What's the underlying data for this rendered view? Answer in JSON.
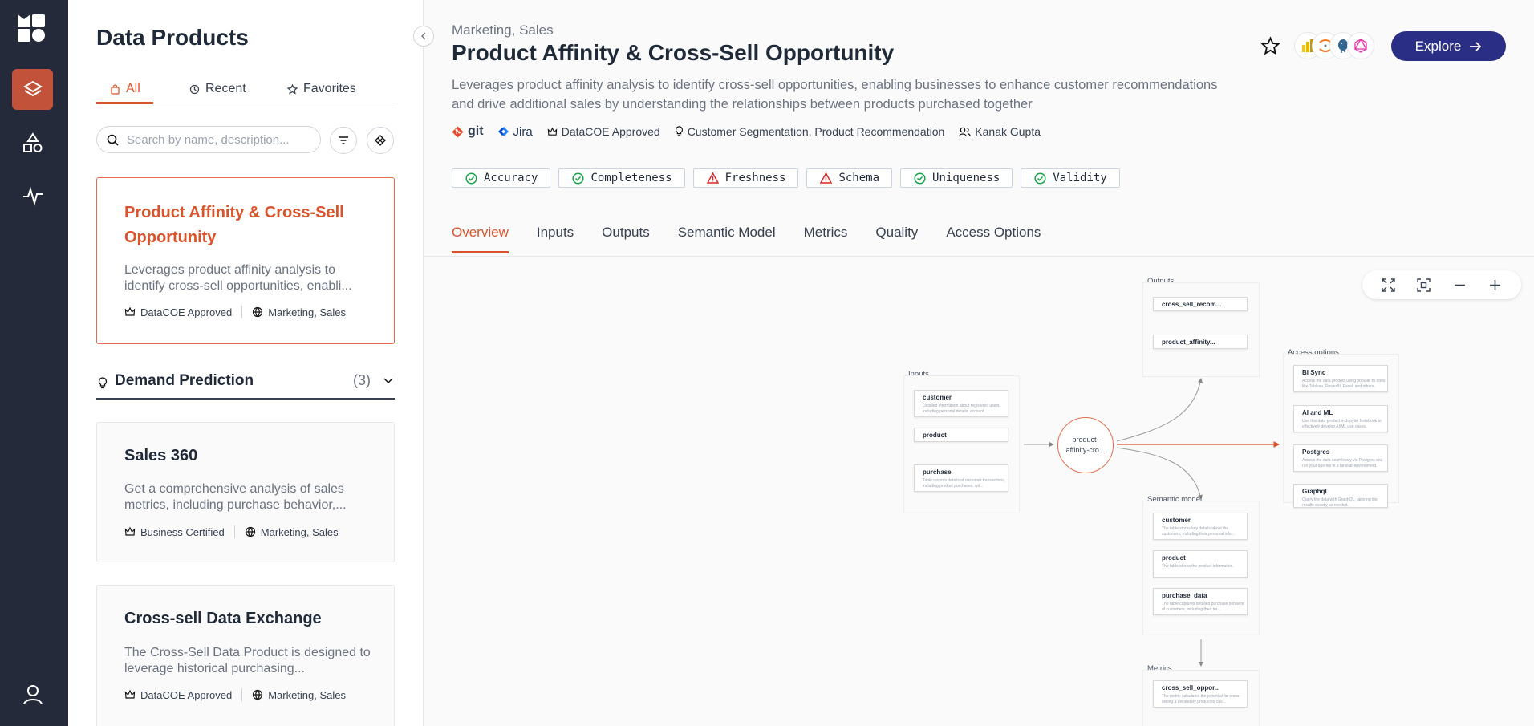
{
  "sidebar": {
    "title": "Data Products",
    "tabs": [
      {
        "label": "All",
        "active": true
      },
      {
        "label": "Recent",
        "active": false
      },
      {
        "label": "Favorites",
        "active": false
      }
    ],
    "search_placeholder": "Search by name, description...",
    "cards_top": [
      {
        "title": "Product Affinity & Cross-Sell Opportunity",
        "desc": "Leverages product affinity analysis to identify cross-sell opportunities, enabli...",
        "badge": "DataCOE Approved",
        "domain": "Marketing, Sales"
      }
    ],
    "group": {
      "title": "Demand Prediction",
      "count": "(3)"
    },
    "cards_group": [
      {
        "title": "Sales 360",
        "desc": "Get a comprehensive analysis of sales metrics, including purchase behavior,...",
        "badge": "Business Certified",
        "domain": "Marketing, Sales"
      },
      {
        "title": "Cross-sell Data Exchange",
        "desc": "The Cross-Sell Data Product is designed to leverage historical purchasing...",
        "badge": "DataCOE Approved",
        "domain": "Marketing, Sales"
      }
    ]
  },
  "main": {
    "domain": "Marketing, Sales",
    "title": "Product Affinity & Cross-Sell Opportunity",
    "desc": "Leverages product affinity analysis to identify cross-sell opportunities, enabling businesses to enhance customer recommendations and drive additional sales by understanding the relationships between products purchased together",
    "meta": {
      "git": "git",
      "jira": "Jira",
      "approval": "DataCOE Approved",
      "use_cases": "Customer Segmentation, Product Recommendation",
      "owner": "Kanak Gupta"
    },
    "checks": [
      {
        "label": "Accuracy",
        "status": "pass"
      },
      {
        "label": "Completeness",
        "status": "pass"
      },
      {
        "label": "Freshness",
        "status": "warn"
      },
      {
        "label": "Schema",
        "status": "warn"
      },
      {
        "label": "Uniqueness",
        "status": "pass"
      },
      {
        "label": "Validity",
        "status": "pass"
      }
    ],
    "tabs": [
      "Overview",
      "Inputs",
      "Outputs",
      "Semantic Model",
      "Metrics",
      "Quality",
      "Access Options"
    ],
    "active_tab": "Overview",
    "explore_label": "Explore",
    "colors": {
      "accent": "#d9542c",
      "primary": "#2a2f85",
      "pass": "#16a34a",
      "warn": "#dc2626"
    }
  },
  "diagram": {
    "hub_label": "product-\naffinity-cro...",
    "inputs": {
      "title": "Inputs",
      "nodes": [
        {
          "name": "customer",
          "desc": "Detailed information about registered users, including personal details, account..."
        },
        {
          "name": "product",
          "desc": ""
        },
        {
          "name": "purchase",
          "desc": "Table records details of customer transactions, including product purchases, wit..."
        }
      ]
    },
    "outputs": {
      "title": "Outputs",
      "nodes": [
        {
          "name": "cross_sell_recom...",
          "desc": ""
        },
        {
          "name": "product_affinity...",
          "desc": ""
        }
      ]
    },
    "semantic": {
      "title": "Semantic model",
      "nodes": [
        {
          "name": "customer",
          "desc": "The table stores key details about the customers, including their personal info..."
        },
        {
          "name": "product",
          "desc": "The table stores the product information."
        },
        {
          "name": "purchase_data",
          "desc": "The table captures detailed purchase behavior of customers, including their tra..."
        }
      ]
    },
    "metrics": {
      "title": "Metrics",
      "nodes": [
        {
          "name": "cross_sell_oppor...",
          "desc": "The metric calculates the potential for cross-selling a secondary product to cus..."
        }
      ]
    },
    "access": {
      "title": "Access options",
      "nodes": [
        {
          "name": "BI Sync",
          "desc": "Access the data product using popular BI tools like Tableau, PowerBI, Excel, and others."
        },
        {
          "name": "AI and ML",
          "desc": "Use this data product in Jupyter Notebook to effectively develop AI/ML use cases."
        },
        {
          "name": "Postgres",
          "desc": "Access the data seamlessly via Postgres and run your queries in a familiar environment."
        },
        {
          "name": "Graphql",
          "desc": "Query the data with GraphQL, tailoring the results exactly as needed."
        }
      ]
    }
  }
}
